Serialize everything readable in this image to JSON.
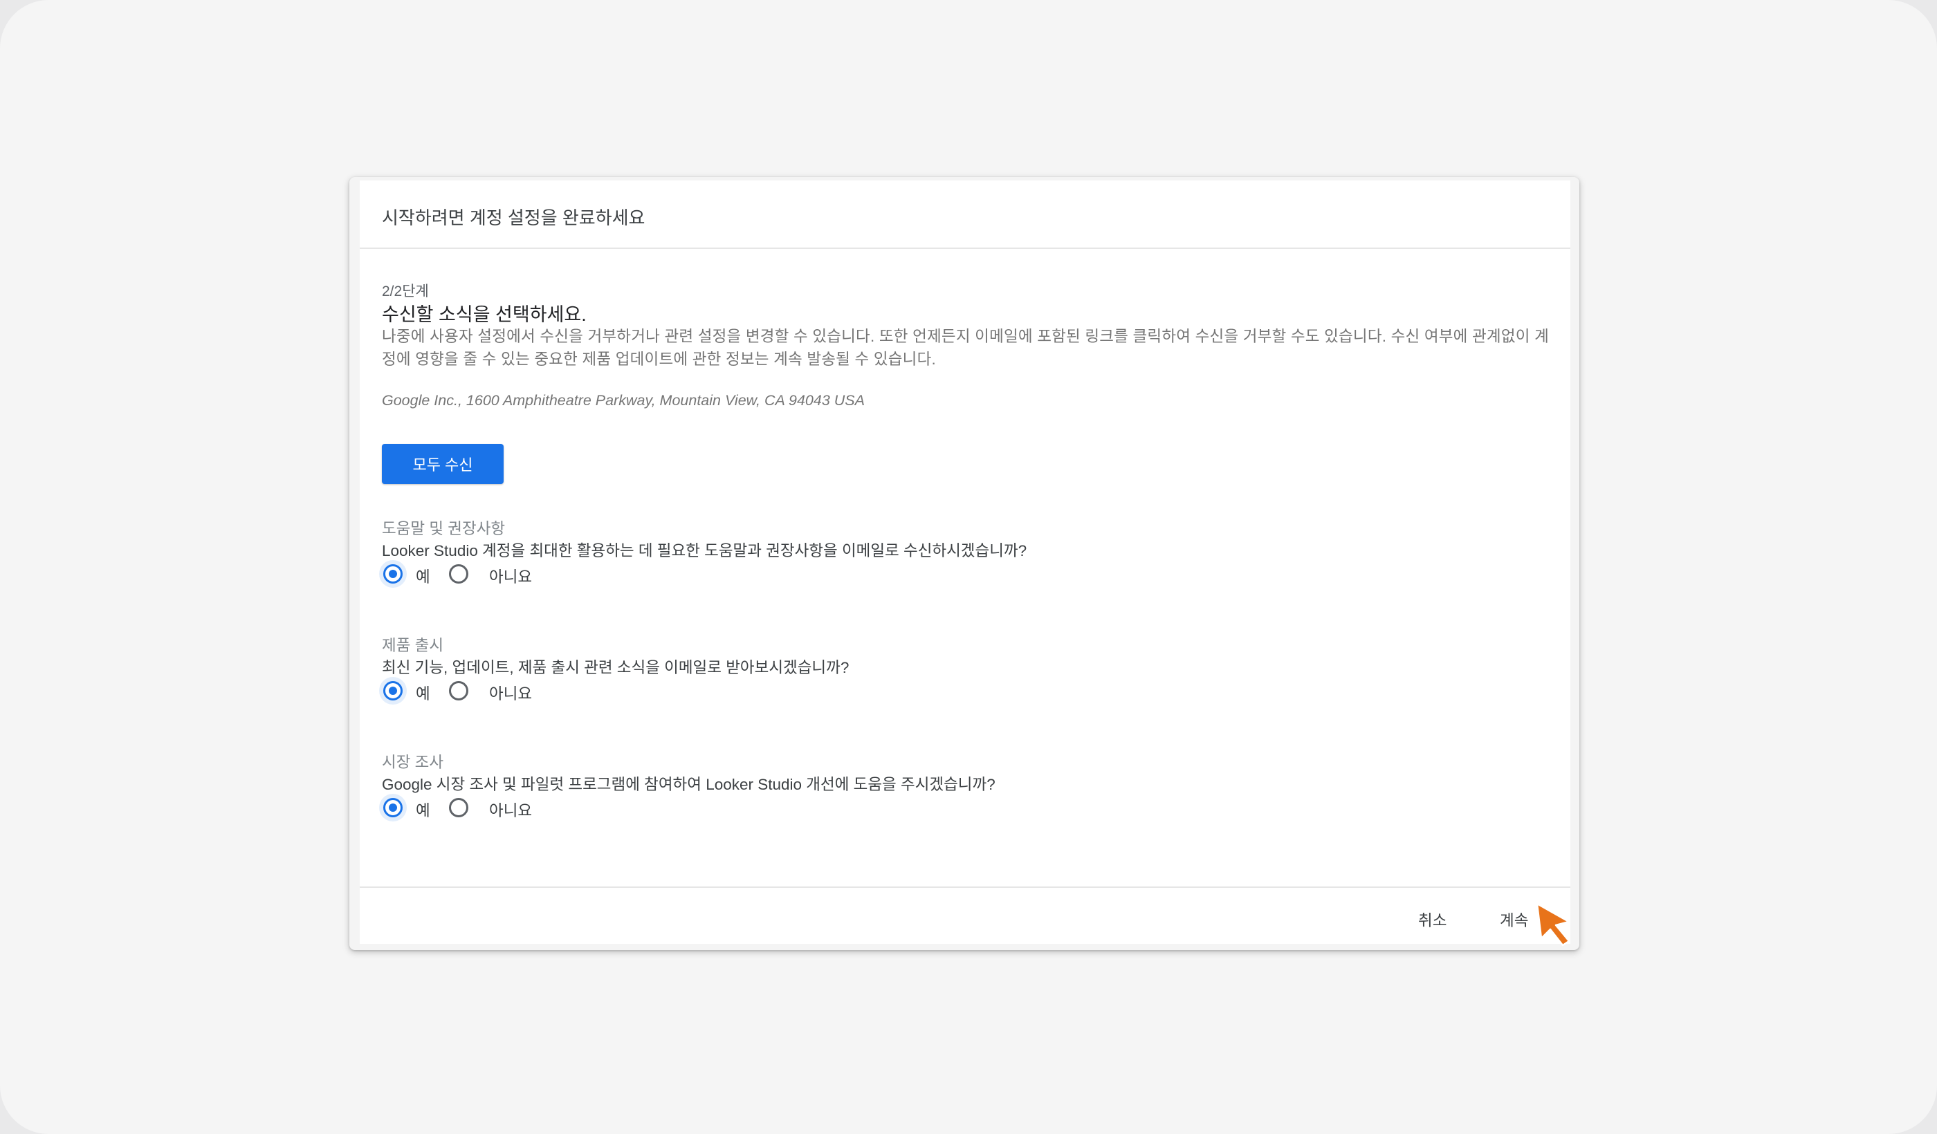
{
  "dialog": {
    "title": "시작하려면 계정 설정을 완료하세요",
    "step": "2/2단계",
    "heading": "수신할 소식을 선택하세요.",
    "description": "나중에 사용자 설정에서 수신을 거부하거나 관련 설정을 변경할 수 있습니다. 또한 언제든지 이메일에 포함된 링크를 클릭하여 수신을 거부할 수도 있습니다. 수신 여부에 관계없이 계정에 영향을 줄 수 있는 중요한 제품 업데이트에 관한 정보는 계속 발송될 수 있습니다.",
    "address": "Google Inc., 1600 Amphitheatre Parkway, Mountain View, CA 94043 USA",
    "accept_all_label": "모두 수신",
    "sections": [
      {
        "title": "도움말 및 권장사항",
        "question": "Looker Studio 계정을 최대한 활용하는 데 필요한 도움말과 권장사항을 이메일로 수신하시겠습니까?",
        "yes_label": "예",
        "no_label": "아니요",
        "selected": "yes"
      },
      {
        "title": "제품 출시",
        "question": "최신 기능, 업데이트, 제품 출시 관련 소식을 이메일로 받아보시겠습니까?",
        "yes_label": "예",
        "no_label": "아니요",
        "selected": "yes"
      },
      {
        "title": "시장 조사",
        "question": "Google 시장 조사 및 파일럿 프로그램에 참여하여 Looker Studio 개선에 도움을 주시겠습니까?",
        "yes_label": "예",
        "no_label": "아니요",
        "selected": "yes"
      }
    ],
    "cancel_label": "취소",
    "continue_label": "계속"
  },
  "colors": {
    "primary": "#1a73e8",
    "cursor": "#e8731a"
  },
  "icons": {
    "cursor": "mouse-pointer-icon"
  }
}
